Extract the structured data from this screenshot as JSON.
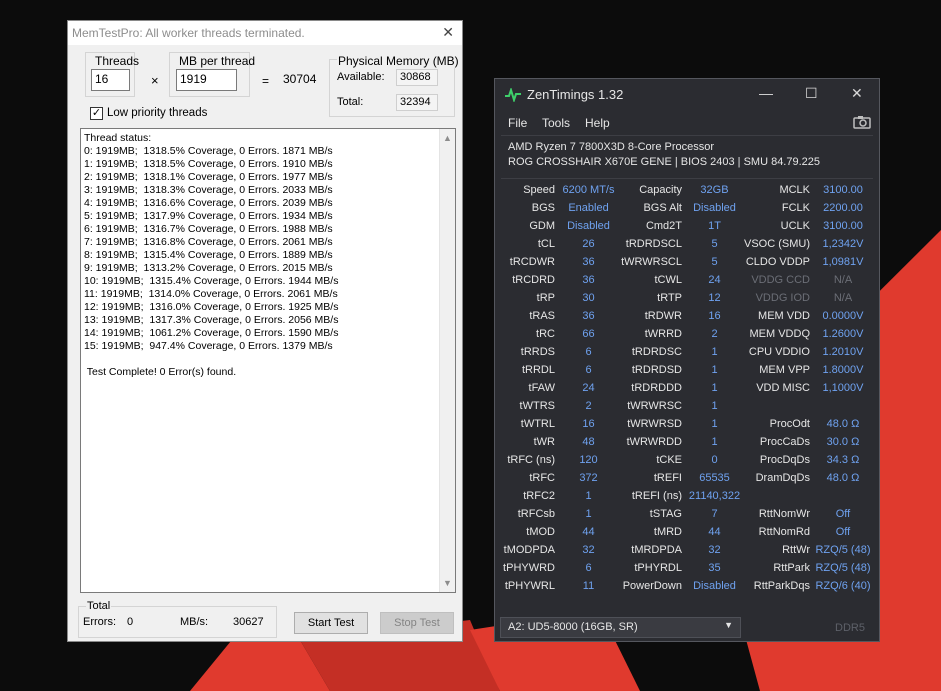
{
  "memtest": {
    "title": "MemTestPro: All worker threads terminated.",
    "threads_label": "Threads",
    "threads_value": "16",
    "mb_label": "MB per thread",
    "mb_value": "1919",
    "times": "×",
    "equals": "=",
    "total_mb": "30704",
    "phys_label": "Physical Memory (MB)",
    "available_label": "Available:",
    "available_value": "30868",
    "total_label": "Total:",
    "total_value": "32394",
    "low_priority_label": "Low priority threads",
    "low_priority_checked": true,
    "status_lines": [
      "Thread status:",
      "0: 1919MB;  1318.5% Coverage, 0 Errors. 1871 MB/s",
      "1: 1919MB;  1318.5% Coverage, 0 Errors. 1910 MB/s",
      "2: 1919MB;  1318.1% Coverage, 0 Errors. 1977 MB/s",
      "3: 1919MB;  1318.3% Coverage, 0 Errors. 2033 MB/s",
      "4: 1919MB;  1316.6% Coverage, 0 Errors. 2039 MB/s",
      "5: 1919MB;  1317.9% Coverage, 0 Errors. 1934 MB/s",
      "6: 1919MB;  1316.7% Coverage, 0 Errors. 1988 MB/s",
      "7: 1919MB;  1316.8% Coverage, 0 Errors. 2061 MB/s",
      "8: 1919MB;  1315.4% Coverage, 0 Errors. 1889 MB/s",
      "9: 1919MB;  1313.2% Coverage, 0 Errors. 2015 MB/s",
      "10: 1919MB;  1315.4% Coverage, 0 Errors. 1944 MB/s",
      "11: 1919MB;  1314.0% Coverage, 0 Errors. 2061 MB/s",
      "12: 1919MB;  1316.0% Coverage, 0 Errors. 1925 MB/s",
      "13: 1919MB;  1317.3% Coverage, 0 Errors. 2056 MB/s",
      "14: 1919MB;  1061.2% Coverage, 0 Errors. 1590 MB/s",
      "15: 1919MB;  947.4% Coverage, 0 Errors. 1379 MB/s",
      "",
      " Test Complete! 0 Error(s) found."
    ],
    "total_group_label": "Total",
    "errors_label": "Errors:",
    "errors_value": "0",
    "mbs_label": "MB/s:",
    "mbs_value": "30627",
    "start_label": "Start Test",
    "stop_label": "Stop Test"
  },
  "zen": {
    "title": "ZenTimings 1.32",
    "minimize": "—",
    "maximize": "☐",
    "close": "✕",
    "menu": [
      "File",
      "Tools",
      "Help"
    ],
    "cpu": "AMD Ryzen 7 7800X3D 8-Core Processor",
    "board": "ROG CROSSHAIR X670E GENE | BIOS 2403 | SMU 84.79.225",
    "rows": [
      [
        [
          "Speed",
          "6200 MT/s"
        ],
        [
          "Capacity",
          "32GB"
        ],
        [
          "MCLK",
          "3100.00"
        ]
      ],
      [
        [
          "BGS",
          "Enabled"
        ],
        [
          "BGS Alt",
          "Disabled"
        ],
        [
          "FCLK",
          "2200.00"
        ]
      ],
      [
        [
          "GDM",
          "Disabled"
        ],
        [
          "Cmd2T",
          "1T"
        ],
        [
          "UCLK",
          "3100.00"
        ]
      ],
      [
        [
          "tCL",
          "26"
        ],
        [
          "tRDRDSCL",
          "5"
        ],
        [
          "VSOC (SMU)",
          "1,2342V"
        ]
      ],
      [
        [
          "tRCDWR",
          "36"
        ],
        [
          "tWRWRSCL",
          "5"
        ],
        [
          "CLDO VDDP",
          "1,0981V"
        ]
      ],
      [
        [
          "tRCDRD",
          "36"
        ],
        [
          "tCWL",
          "24"
        ],
        [
          "VDDG CCD",
          "N/A"
        ]
      ],
      [
        [
          "tRP",
          "30"
        ],
        [
          "tRTP",
          "12"
        ],
        [
          "VDDG IOD",
          "N/A"
        ]
      ],
      [
        [
          "tRAS",
          "36"
        ],
        [
          "tRDWR",
          "16"
        ],
        [
          "MEM VDD",
          "0.0000V"
        ]
      ],
      [
        [
          "tRC",
          "66"
        ],
        [
          "tWRRD",
          "2"
        ],
        [
          "MEM VDDQ",
          "1.2600V"
        ]
      ],
      [
        [
          "tRRDS",
          "6"
        ],
        [
          "tRDRDSC",
          "1"
        ],
        [
          "CPU VDDIO",
          "1.2010V"
        ]
      ],
      [
        [
          "tRRDL",
          "6"
        ],
        [
          "tRDRDSD",
          "1"
        ],
        [
          "MEM VPP",
          "1.8000V"
        ]
      ],
      [
        [
          "tFAW",
          "24"
        ],
        [
          "tRDRDDD",
          "1"
        ],
        [
          "VDD MISC",
          "1,1000V"
        ]
      ],
      [
        [
          "tWTRS",
          "2"
        ],
        [
          "tWRWRSC",
          "1"
        ],
        [
          "",
          ""
        ]
      ],
      [
        [
          "tWTRL",
          "16"
        ],
        [
          "tWRWRSD",
          "1"
        ],
        [
          "ProcOdt",
          "48.0 Ω"
        ]
      ],
      [
        [
          "tWR",
          "48"
        ],
        [
          "tWRWRDD",
          "1"
        ],
        [
          "ProcCaDs",
          "30.0 Ω"
        ]
      ],
      [
        [
          "tRFC (ns)",
          "120"
        ],
        [
          "tCKE",
          "0"
        ],
        [
          "ProcDqDs",
          "34.3 Ω"
        ]
      ],
      [
        [
          "tRFC",
          "372"
        ],
        [
          "tREFI",
          "65535"
        ],
        [
          "DramDqDs",
          "48.0 Ω"
        ]
      ],
      [
        [
          "tRFC2",
          "1"
        ],
        [
          "tREFI (ns)",
          "21140,322"
        ],
        [
          "",
          ""
        ]
      ],
      [
        [
          "tRFCsb",
          "1"
        ],
        [
          "tSTAG",
          "7"
        ],
        [
          "RttNomWr",
          "Off"
        ]
      ],
      [
        [
          "tMOD",
          "44"
        ],
        [
          "tMRD",
          "44"
        ],
        [
          "RttNomRd",
          "Off"
        ]
      ],
      [
        [
          "tMODPDA",
          "32"
        ],
        [
          "tMRDPDA",
          "32"
        ],
        [
          "RttWr",
          "RZQ/5 (48)"
        ]
      ],
      [
        [
          "tPHYWRD",
          "6"
        ],
        [
          "tPHYRDL",
          "35"
        ],
        [
          "RttPark",
          "RZQ/5 (48)"
        ]
      ],
      [
        [
          "tPHYWRL",
          "11"
        ],
        [
          "PowerDown",
          "Disabled"
        ],
        [
          "RttParkDqs",
          "RZQ/6 (40)"
        ]
      ]
    ],
    "dimm": "A2: UD5-8000 (16GB, SR)",
    "ddr": "DDR5"
  },
  "colors": {
    "zen_bg": "#2b2c31",
    "zen_value": "#6fa2f0",
    "wallpaper_red": "#e03a2e"
  }
}
